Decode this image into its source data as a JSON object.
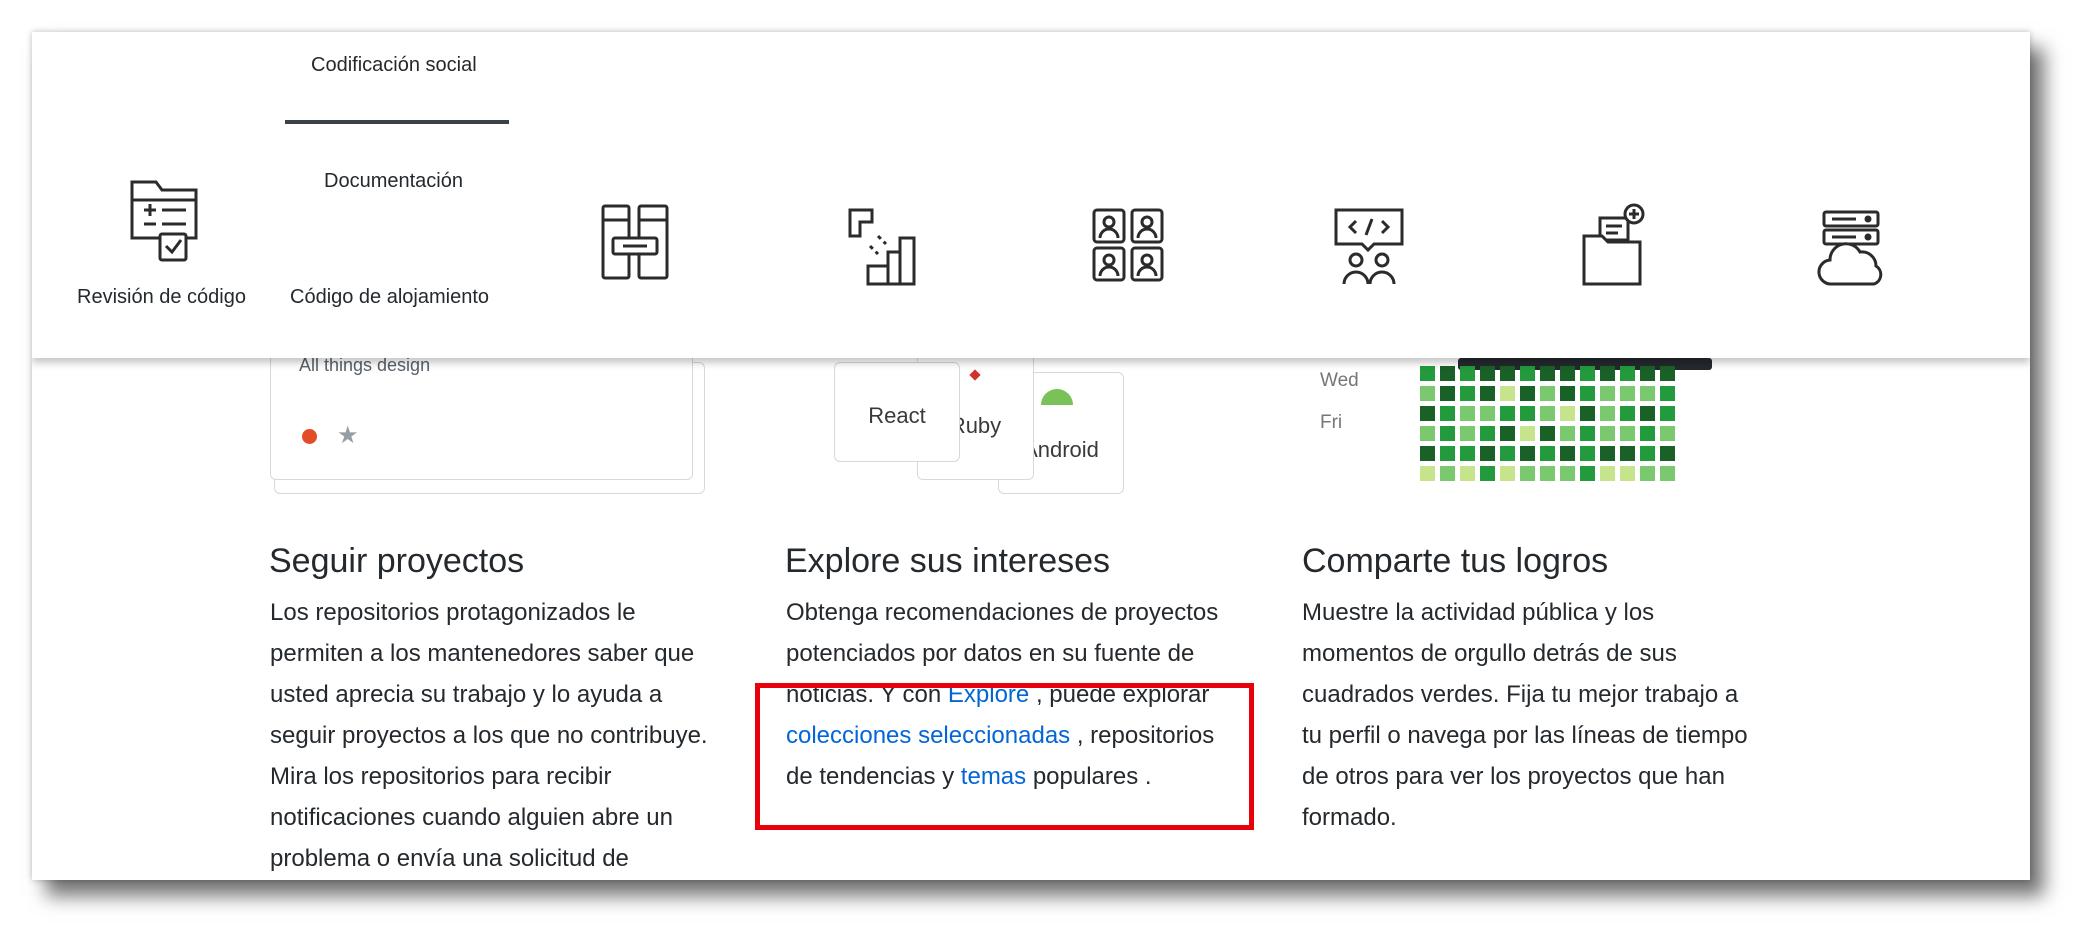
{
  "nav": {
    "tab_active": "Codificación social",
    "tab_docs": "Documentación",
    "code_review": "Revisión de código",
    "hosting": "Código de alojamiento",
    "icons": [
      "code-review-icon",
      "integrations-icon",
      "project-management-icon",
      "team-management-icon",
      "social-coding-icon",
      "documentation-icon",
      "code-hosting-icon"
    ]
  },
  "previews": {
    "card_caption": "All things design",
    "topics": [
      "React",
      "Ruby",
      "Android"
    ],
    "days": [
      "Wed",
      "Fri"
    ]
  },
  "features": [
    {
      "title": "Seguir proyectos",
      "body": "Los repositorios protagonizados le permiten a los mantenedores saber que usted aprecia su trabajo y lo ayuda a seguir proyectos a los que no contribuye. Mira los repositorios para recibir notificaciones cuando alguien abre un problema o envía una solicitud de"
    },
    {
      "title": "Explore sus intereses",
      "body_1": "Obtenga recomendaciones de proyectos potenciados por datos en su fuente de noticias. Y con",
      "link_explore": "Explore",
      "body_2": ", puede explorar",
      "link_collections": "colecciones seleccionadas",
      "body_3": ", repositorios de tendencias y",
      "link_topics": "temas",
      "body_4": "populares ."
    },
    {
      "title": "Comparte tus logros",
      "body": "Muestre la actividad pública y los momentos de orgullo detrás de sus cuadrados verdes. Fija tu mejor trabajo a tu perfil o navega por las líneas de tiempo de otros para ver los proyectos que han formado."
    }
  ],
  "colors": {
    "link": "#0366d6",
    "highlight": "#e8000a",
    "contrib_levels": [
      "#ebedf0",
      "#c6e48b",
      "#7bc96f",
      "#239a3b",
      "#196127"
    ]
  }
}
